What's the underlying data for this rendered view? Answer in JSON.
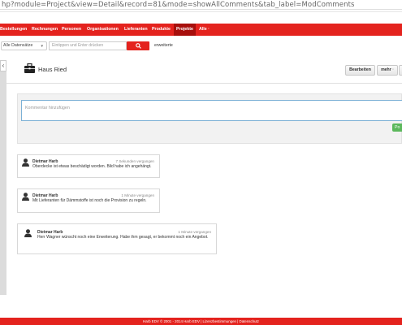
{
  "browser": {
    "url": "hp?module=Project&view=Detail&record=81&mode=showAllComments&tab_label=ModComments"
  },
  "nav": {
    "items": [
      "Bestellungen",
      "Rechnungen",
      "Personen",
      "Organisationen",
      "Lieferanten",
      "Produkte",
      "Projekte",
      "Alle ·"
    ],
    "active": "Projekte",
    "brand_color": "#e4231e"
  },
  "subbar": {
    "select_value": "Alle Datensätze",
    "search_placeholder": "Eintippen und Enter drücken",
    "advanced_link": "erweiterte"
  },
  "record": {
    "title": "Haus Ried",
    "icon": "briefcase-icon",
    "buttons": {
      "edit": "Bearbeiten",
      "more": "mehr",
      "more_caret": "·"
    }
  },
  "comment_form": {
    "placeholder": "Kommentar hinzufügen",
    "post_label": "Po"
  },
  "comments": [
    {
      "author": "Dietmar Harb",
      "time": "7 Sekunden vergangen",
      "text": "Oberdecke ist etwas beschädigt worden. Bild habe ich angehängt."
    },
    {
      "author": "Dietmar Harb",
      "time": "1 Minute vergangen",
      "text": "Mit Lieferanten für Dämmstoffe ist noch die Provision zu regeln."
    },
    {
      "author": "Dietmar Harb",
      "time": "1 Minute vergangen",
      "text": "Herr Wagner wünscht noch eine Erweiterung. Habe ihm gesagt, er bekommt noch ein Angebot."
    }
  ],
  "footer": {
    "text": "Harb EDV © 2001 - 2014 Harb EDV | Lizenzbestimmungen | Datenschutz"
  }
}
